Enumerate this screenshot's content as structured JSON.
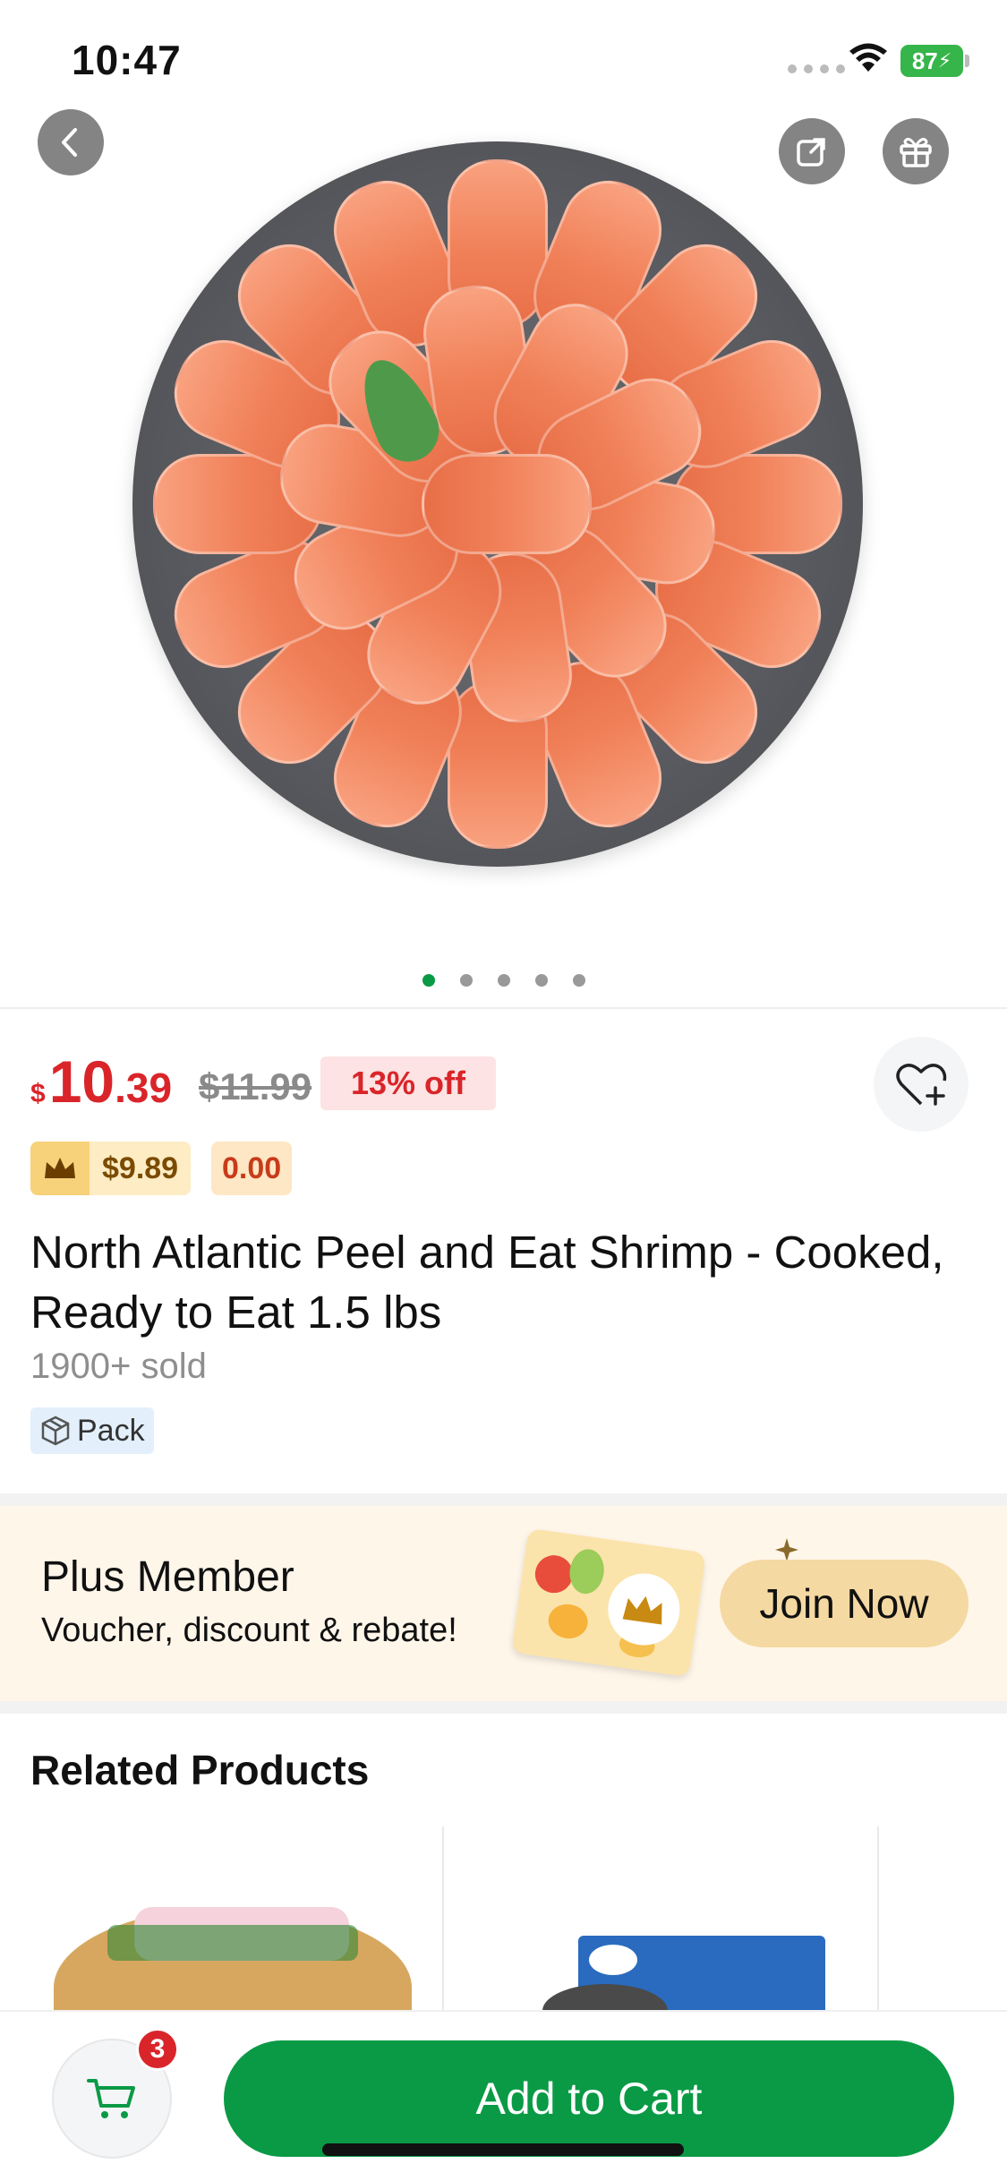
{
  "status_bar": {
    "time": "10:47",
    "battery": "87"
  },
  "icons": {
    "back": "chevron-left-icon",
    "share": "share-icon",
    "gift": "gift-icon",
    "favorite": "heart-plus-icon",
    "crown": "crown-icon",
    "pack": "box-icon",
    "cart": "cart-icon"
  },
  "gallery": {
    "dot_count": 5,
    "active_index": 0
  },
  "product": {
    "price_currency": "$",
    "price_int": "10",
    "price_dec": ".39",
    "original_price": "$11.99",
    "discount": "13% off",
    "member_price": "$9.89",
    "points": "0.00",
    "title": "North Atlantic Peel and Eat Shrimp - Cooked, Ready to Eat 1.5 lbs",
    "sold": "1900+ sold",
    "tag": "Pack"
  },
  "plus_banner": {
    "title": "Plus Member",
    "subtitle": "Voucher, discount & rebate!",
    "button": "Join Now"
  },
  "related": {
    "title": "Related Products"
  },
  "bottom_bar": {
    "cart_count": "3",
    "add_to_cart": "Add to Cart"
  },
  "colors": {
    "brand_green": "#0a9a45",
    "price_red": "#d9252a",
    "member_gold": "#f7d27a",
    "banner_bg": "#fff6ea"
  }
}
